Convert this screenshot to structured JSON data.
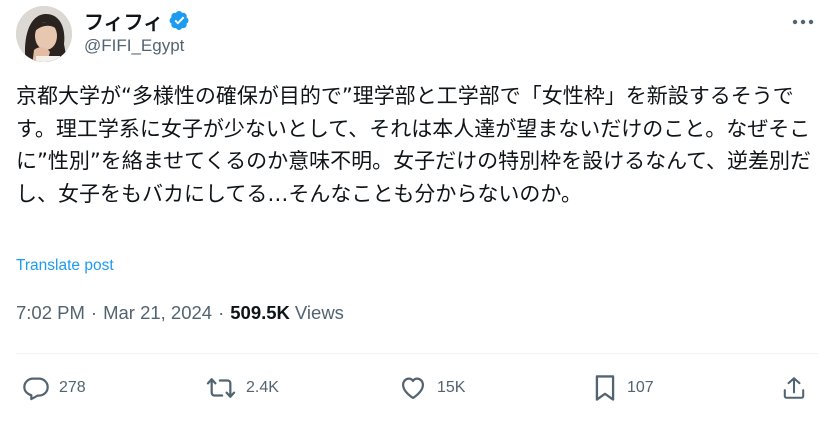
{
  "author": {
    "display_name": "フィフィ",
    "handle": "@FIFI_Egypt",
    "verified_icon": "verified-badge-icon",
    "verified_color": "#1d9bf0"
  },
  "tweet": {
    "text": "京都大学が“多様性の確保が目的で”理学部と工学部で「女性枠」を新設するそうです。理工学系に女子が少ないとして、それは本人達が望まないだけのこと。なぜそこに”性別”を絡ませてくるのか意味不明。女子だけの特別枠を設けるなんて、逆差別だし、女子をもバカにしてる…そんなことも分からないのか。",
    "translate_label": "Translate post",
    "time": "7:02 PM",
    "date": "Mar 21, 2024",
    "separator": "·",
    "views_count": "509.5K",
    "views_label": "Views"
  },
  "actions": {
    "replies": "278",
    "reposts": "2.4K",
    "likes": "15K",
    "bookmarks": "107"
  },
  "colors": {
    "text": "#0f1419",
    "secondary": "#536471",
    "link": "#1d9bf0",
    "divider": "#eff3f4"
  }
}
